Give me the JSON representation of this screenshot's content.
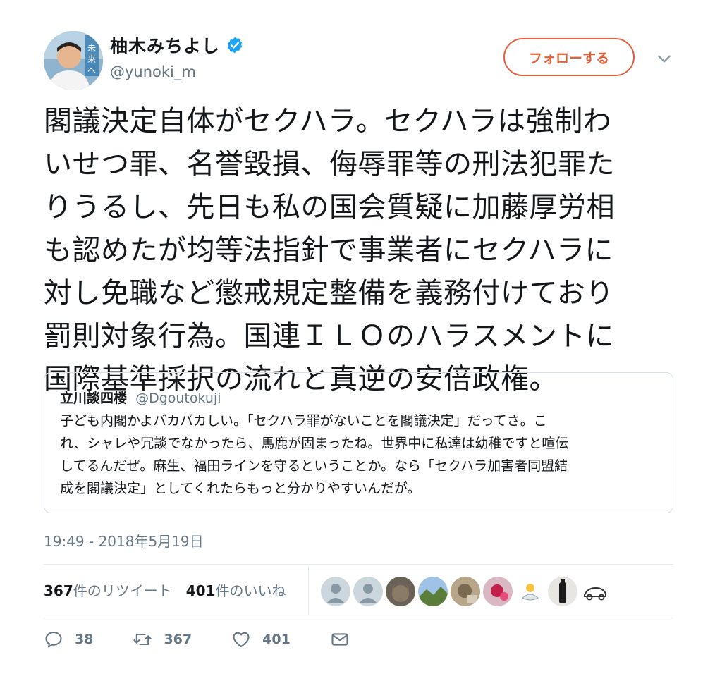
{
  "author": {
    "name": "柚木みちよし",
    "handle": "@yunoki_m",
    "avatar_caption": "未来へ"
  },
  "follow_button": {
    "label": "フォローする"
  },
  "tweet": {
    "lines": [
      "閣議決定自体がセクハラ。セクハラは強制わ",
      "いせつ罪、名誉毀損、侮辱罪等の刑法犯罪た",
      "りうるし、先日も私の国会質疑に加藤厚労相",
      "も認めたが均等法指針で事業者にセクハラに",
      "対し免職など懲戒規定整備を義務付けており",
      "罰則対象行為。国連ＩＬＯのハラスメントに",
      "国際基準採択の流れと真逆の安倍政権。"
    ]
  },
  "quoted_tweet": {
    "name": "立川談四楼",
    "handle": "@Dgoutokuji",
    "lines": [
      "子ども内閣かよバカバカしい。「セクハラ罪がないことを閣議決定」だってさ。こ",
      "れ、シャレや冗談でなかったら、馬鹿が固まったね。世界中に私達は幼稚ですと喧伝",
      "してるんだぜ。麻生、福田ラインを守るということか。なら「セクハラ加害者同盟結",
      "成を閣議決定」としてくれたらもっと分かりやすいんだが。"
    ]
  },
  "timestamp": "19:49 - 2018年5月19日",
  "stats": {
    "retweets_count": "367",
    "retweets_label": "件のリツイート",
    "likes_count": "401",
    "likes_label": "件のいいね"
  },
  "actions": {
    "reply_count": "38",
    "retweet_count": "367",
    "like_count": "401"
  },
  "colors": {
    "accent": "#e0603b",
    "verified": "#1da1f2",
    "muted": "#657786"
  }
}
